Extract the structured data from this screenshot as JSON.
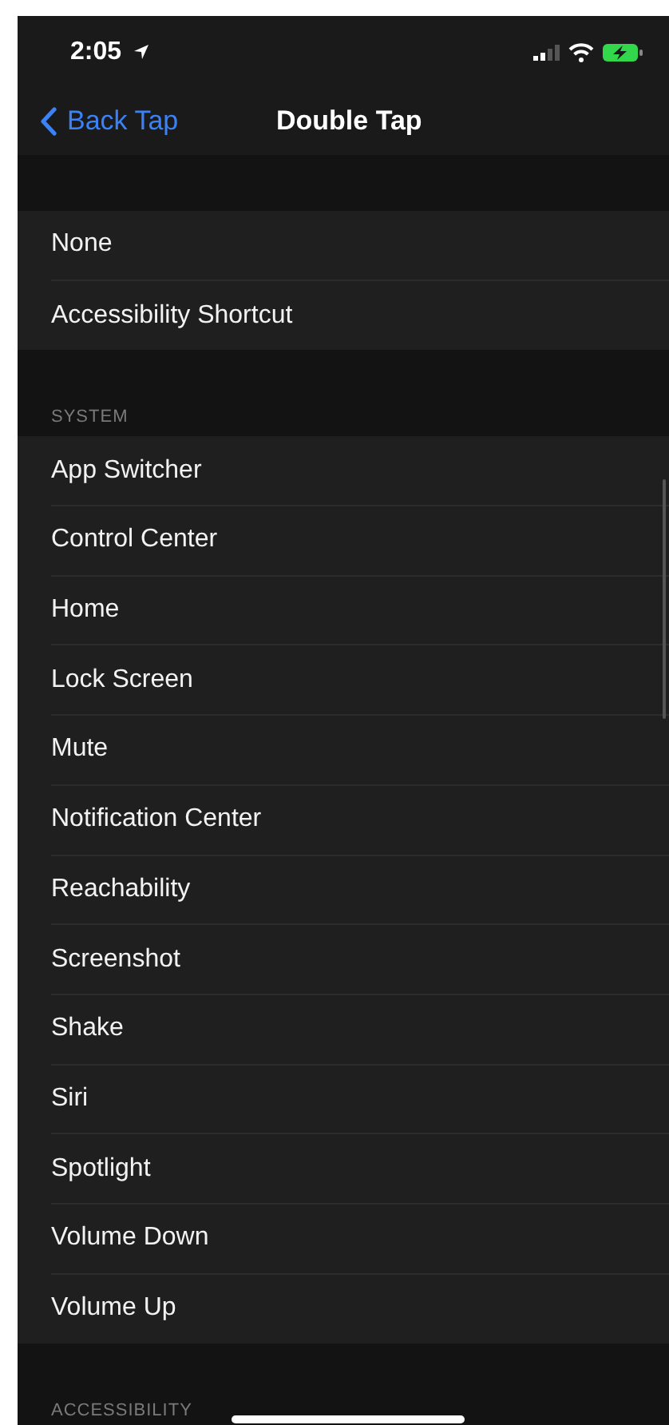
{
  "status_bar": {
    "time": "2:05"
  },
  "nav": {
    "back": "Back Tap",
    "title": "Double Tap"
  },
  "sections": [
    {
      "items": [
        {
          "label": "None"
        },
        {
          "label": "Accessibility Shortcut"
        }
      ]
    },
    {
      "header": "SYSTEM",
      "items": [
        {
          "label": "App Switcher"
        },
        {
          "label": "Control Center"
        },
        {
          "label": "Home"
        },
        {
          "label": "Lock Screen"
        },
        {
          "label": "Mute"
        },
        {
          "label": "Notification Center"
        },
        {
          "label": "Reachability"
        },
        {
          "label": "Screenshot"
        },
        {
          "label": "Shake"
        },
        {
          "label": "Siri"
        },
        {
          "label": "Spotlight"
        },
        {
          "label": "Volume Down"
        },
        {
          "label": "Volume Up"
        }
      ]
    },
    {
      "header": "ACCESSIBILITY"
    }
  ]
}
